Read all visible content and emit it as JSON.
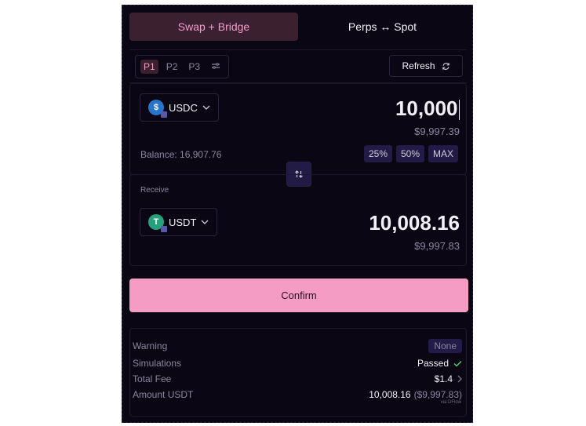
{
  "tabs": [
    {
      "label": "Swap + Bridge"
    },
    {
      "label": "Perps ↔ Spot"
    }
  ],
  "presets": [
    {
      "label": "P1"
    },
    {
      "label": "P2"
    },
    {
      "label": "P3"
    }
  ],
  "refresh_label": "Refresh",
  "from": {
    "token": "USDC",
    "amount": "10,000",
    "usd": "$9,997.39",
    "balance": "Balance: 16,907.76",
    "percent_buttons": [
      "25%",
      "50%",
      "MAX"
    ]
  },
  "to": {
    "label": "Receive",
    "token": "USDT",
    "amount": "10,008.16",
    "usd": "$9,997.83"
  },
  "confirm_label": "Confirm",
  "details": {
    "warning_label": "Warning",
    "warning_value": "None",
    "simulations_label": "Simulations",
    "simulations_value": "Passed",
    "fee_label": "Total Fee",
    "fee_value": "$1.4",
    "amount_label": "Amount USDT",
    "amount_value": "10,008.16",
    "amount_usd": "($9,997.83)",
    "via": "via DFlow"
  },
  "colors": {
    "background": "#0a0614",
    "accent": "#f59cc4",
    "usdc": "#2775ca",
    "usdt": "#26a17b",
    "success": "#4ade80"
  }
}
